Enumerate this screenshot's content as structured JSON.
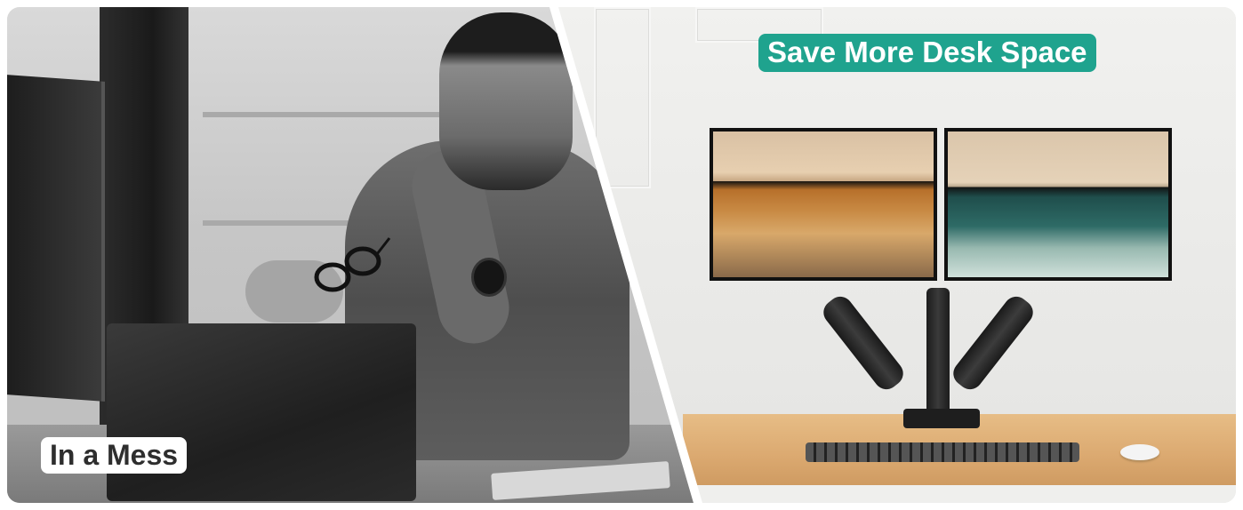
{
  "banner": {
    "left_caption": "In a Mess",
    "right_caption": "Save More Desk Space"
  },
  "colors": {
    "caption_accent": "#1fa38e",
    "caption_plain_bg": "#ffffff",
    "desk_wood": "#dba970"
  }
}
